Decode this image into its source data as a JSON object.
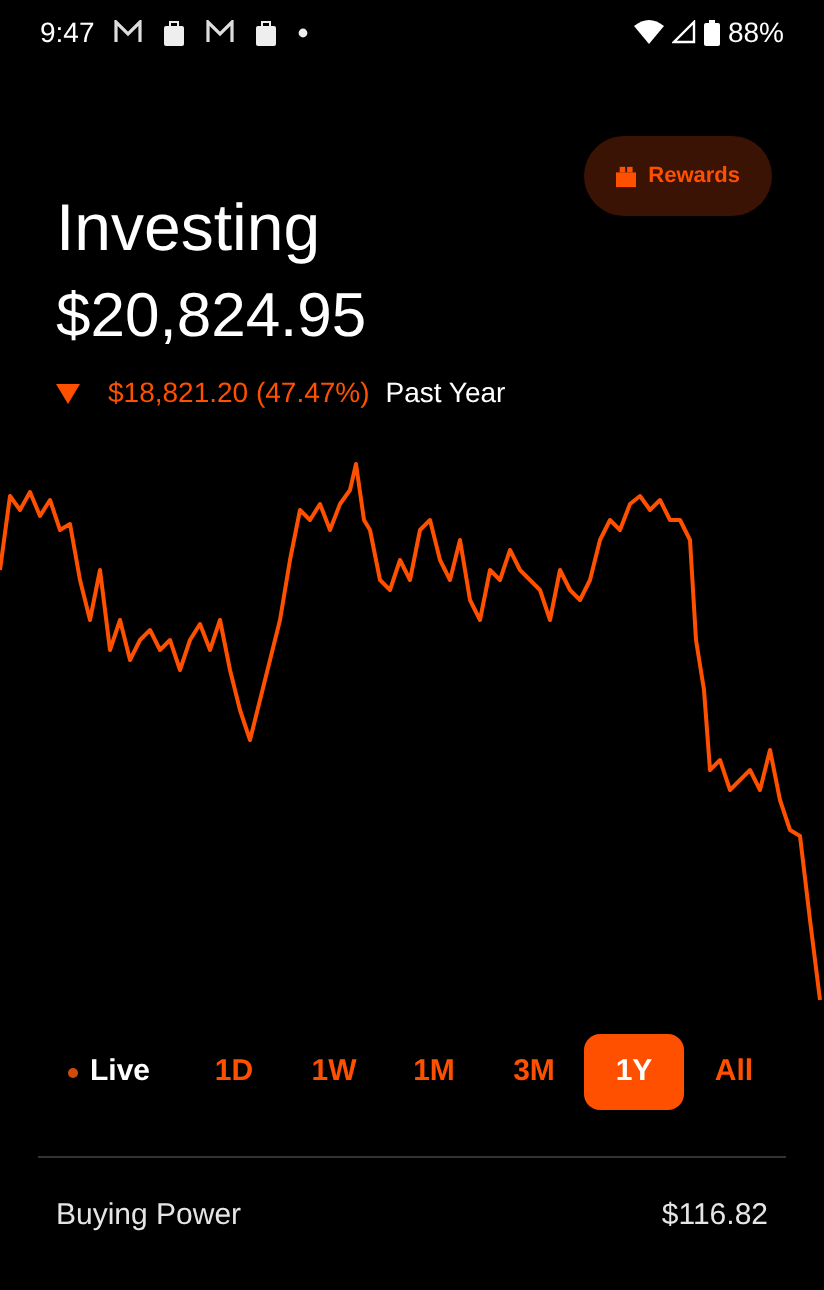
{
  "status_bar": {
    "time": "9:47",
    "battery": "88%"
  },
  "header": {
    "title": "Investing",
    "value": "$20,824.95",
    "change": "$18,821.20 (47.47%)",
    "period": "Past Year"
  },
  "rewards_button": {
    "label": "Rewards"
  },
  "live": {
    "label": "Live"
  },
  "ranges": [
    {
      "label": "1D",
      "selected": false
    },
    {
      "label": "1W",
      "selected": false
    },
    {
      "label": "1M",
      "selected": false
    },
    {
      "label": "3M",
      "selected": false
    },
    {
      "label": "1Y",
      "selected": true
    },
    {
      "label": "All",
      "selected": false
    }
  ],
  "buying_power": {
    "label": "Buying Power",
    "value": "$116.82"
  }
}
